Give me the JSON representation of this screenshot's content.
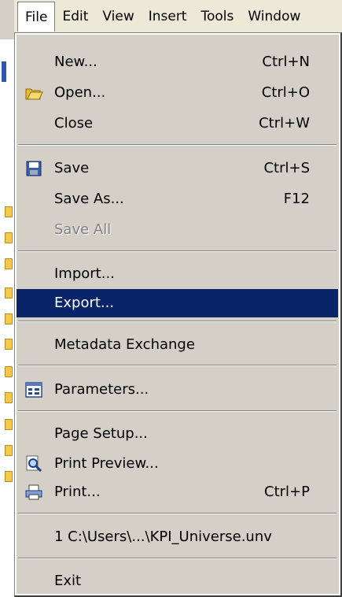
{
  "menubar": {
    "items": [
      {
        "label": "File"
      },
      {
        "label": "Edit"
      },
      {
        "label": "View"
      },
      {
        "label": "Insert"
      },
      {
        "label": "Tools"
      },
      {
        "label": "Window"
      }
    ]
  },
  "file_menu": {
    "new": {
      "label": "New...",
      "shortcut": "Ctrl+N"
    },
    "open": {
      "label": "Open...",
      "shortcut": "Ctrl+O",
      "icon": "open-folder-icon"
    },
    "close": {
      "label": "Close",
      "shortcut": "Ctrl+W"
    },
    "save": {
      "label": "Save",
      "shortcut": "Ctrl+S",
      "icon": "floppy-disk-icon"
    },
    "save_as": {
      "label": "Save As...",
      "shortcut": "F12"
    },
    "save_all": {
      "label": "Save All",
      "disabled": true
    },
    "import": {
      "label": "Import..."
    },
    "export": {
      "label": "Export...",
      "highlighted": true
    },
    "metadata_exchange": {
      "label": "Metadata Exchange"
    },
    "parameters": {
      "label": "Parameters...",
      "icon": "parameters-icon"
    },
    "page_setup": {
      "label": "Page Setup..."
    },
    "print_preview": {
      "label": "Print Preview...",
      "icon": "print-preview-icon"
    },
    "print": {
      "label": "Print...",
      "shortcut": "Ctrl+P",
      "icon": "printer-icon"
    },
    "recent_1": {
      "label": "1 C:\\Users\\...\\KPI_Universe.unv"
    },
    "exit": {
      "label": "Exit"
    }
  },
  "colors": {
    "menu_bg": "#d4d0c8",
    "highlight_bg": "#0a246a",
    "highlight_text": "#ffffff",
    "disabled_text": "#808080"
  }
}
